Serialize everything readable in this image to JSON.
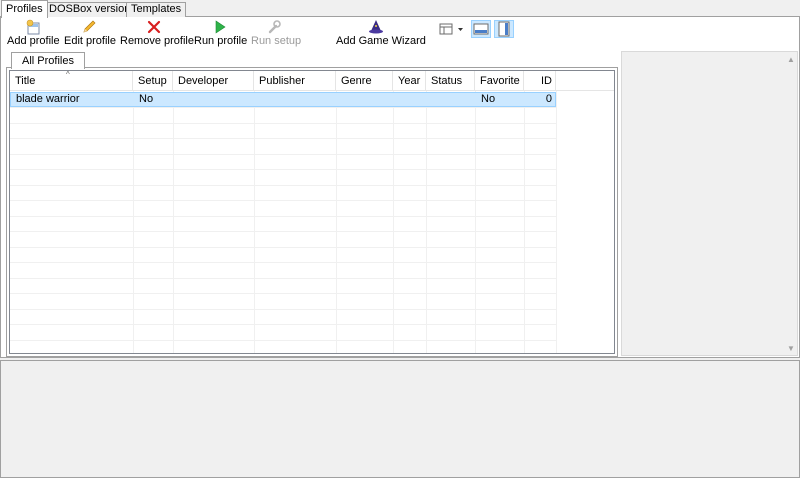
{
  "tabs": [
    {
      "label": "Profiles",
      "active": true
    },
    {
      "label": "DOSBox versions",
      "active": false
    },
    {
      "label": "Templates",
      "active": false
    }
  ],
  "toolbar": {
    "add_profile": "Add profile",
    "edit_profile": "Edit profile",
    "remove_profile": "Remove profile",
    "run_profile": "Run profile",
    "run_setup": "Run setup",
    "add_game_wizard": "Add Game Wizard"
  },
  "profiles_tab": {
    "label": "All Profiles"
  },
  "table": {
    "columns": [
      "Title",
      "Setup",
      "Developer",
      "Publisher",
      "Genre",
      "Year",
      "Status",
      "Favorite",
      "ID"
    ],
    "sort_column": "Title",
    "rows": [
      {
        "title": "blade warrior",
        "setup": "No",
        "developer": "",
        "publisher": "",
        "genre": "",
        "year": "",
        "status": "",
        "favorite": "No",
        "id": "0"
      }
    ]
  },
  "colors": {
    "selection": "#cce8ff",
    "selection_border": "#99d1ff",
    "remove_icon": "#d81e1e",
    "run_icon": "#2fb34a",
    "wizard_icon": "#3a2c84"
  },
  "icons": {
    "add_profile": "add-profile-icon",
    "edit_profile": "pencil-icon",
    "remove_profile": "red-x-icon",
    "run_profile": "play-icon",
    "run_setup": "wrench-icon",
    "add_game_wizard": "wizard-hat-icon",
    "view_columns": "table-view-icon",
    "layout_horizontal": "horizontal-layout-icon",
    "layout_vertical": "vertical-layout-icon"
  }
}
